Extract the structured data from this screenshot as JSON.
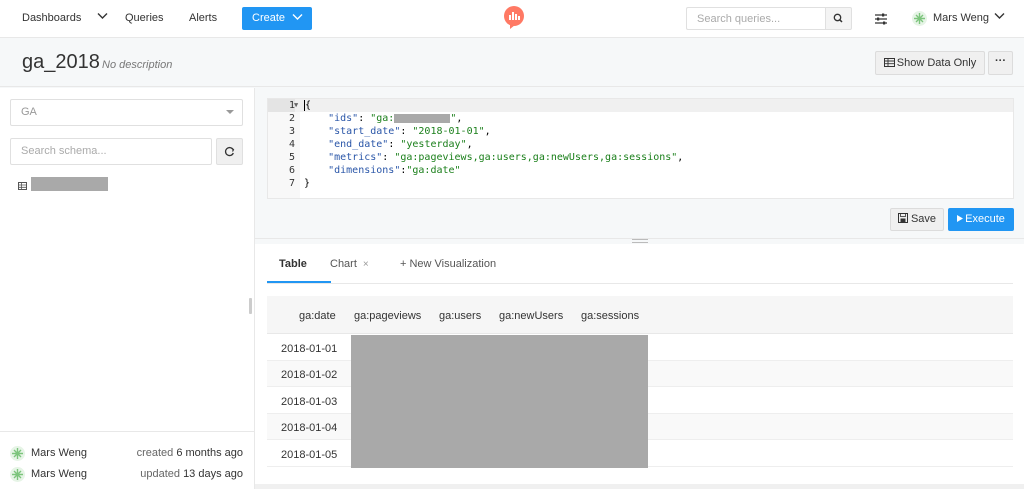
{
  "nav": {
    "dashboards": "Dashboards",
    "queries": "Queries",
    "alerts": "Alerts",
    "create": "Create",
    "search_placeholder": "Search queries...",
    "user_name": "Mars Weng"
  },
  "header": {
    "title": "ga_2018",
    "description": "No description",
    "show_data_only": "Show Data Only",
    "more": "···"
  },
  "sidebar": {
    "data_source": "GA",
    "schema_placeholder": "Search schema..."
  },
  "editor": {
    "line_numbers": [
      "1",
      "2",
      "3",
      "4",
      "5",
      "6",
      "7"
    ],
    "keys": {
      "ids": "\"ids\"",
      "start_date": "\"start_date\"",
      "end_date": "\"end_date\"",
      "metrics": "\"metrics\"",
      "dimensions": "\"dimensions\""
    },
    "values": {
      "ids_prefix": "\"ga:",
      "start_date": "\"2018-01-01\"",
      "end_date": "\"yesterday\"",
      "metrics": "\"ga:pageviews,ga:users,ga:newUsers,ga:sessions\"",
      "dimensions": "\"ga:date\""
    },
    "save": "Save",
    "execute": "Execute"
  },
  "results": {
    "tabs": {
      "table": "Table",
      "chart": "Chart",
      "new_viz": "+ New Visualization"
    },
    "columns": [
      "ga:date",
      "ga:pageviews",
      "ga:users",
      "ga:newUsers",
      "ga:sessions"
    ],
    "dates": [
      "2018-01-01",
      "2018-01-02",
      "2018-01-03",
      "2018-01-04",
      "2018-01-05"
    ]
  },
  "footer": {
    "created_by": "Mars Weng",
    "created_label": "created",
    "created_when": "6 months ago",
    "updated_by": "Mars Weng",
    "updated_label": "updated",
    "updated_when": "13 days ago"
  },
  "colors": {
    "accent": "#2196f3",
    "logo": "#ff7964",
    "redaction": "#a9a9a9"
  },
  "icons": [
    "chevron-down-icon",
    "redash-logo",
    "search-icon",
    "sliders-icon",
    "avatar-icon",
    "table-icon",
    "refresh-icon",
    "save-icon",
    "play-icon",
    "close-icon"
  ]
}
